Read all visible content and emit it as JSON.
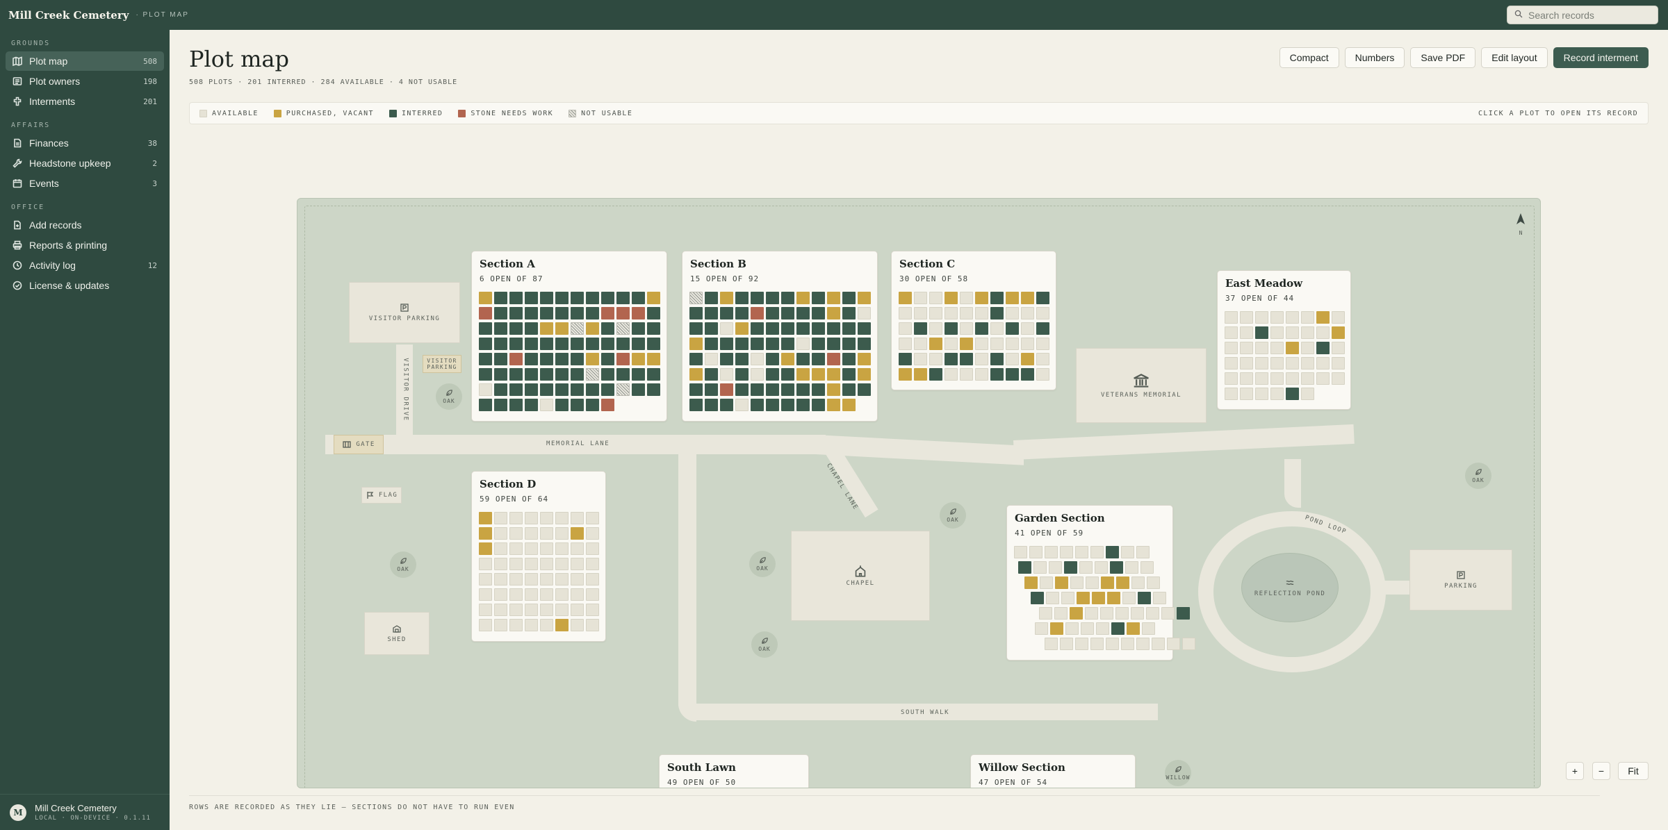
{
  "app": {
    "title": "Mill Creek Cemetery",
    "subtitle": "· PLOT MAP"
  },
  "search": {
    "placeholder": "Search records"
  },
  "sidebar": {
    "groups": [
      {
        "label": "GROUNDS",
        "items": [
          {
            "label": "Plot map",
            "count": "508",
            "icon": "map-icon",
            "active": true
          },
          {
            "label": "Plot owners",
            "count": "198",
            "icon": "list-icon"
          },
          {
            "label": "Interments",
            "count": "201",
            "icon": "cross-icon"
          }
        ]
      },
      {
        "label": "AFFAIRS",
        "items": [
          {
            "label": "Finances",
            "count": "38",
            "icon": "ledger-icon"
          },
          {
            "label": "Headstone upkeep",
            "count": "2",
            "icon": "wrench-icon"
          },
          {
            "label": "Events",
            "count": "3",
            "icon": "calendar-icon"
          }
        ]
      },
      {
        "label": "OFFICE",
        "items": [
          {
            "label": "Add records",
            "count": "",
            "icon": "doc-plus-icon"
          },
          {
            "label": "Reports & printing",
            "count": "",
            "icon": "printer-icon"
          },
          {
            "label": "Activity log",
            "count": "12",
            "icon": "clock-icon"
          },
          {
            "label": "License & updates",
            "count": "",
            "icon": "check-circle-icon"
          }
        ]
      }
    ],
    "footer": {
      "avatar": "M",
      "name": "Mill Creek Cemetery",
      "meta": "LOCAL · ON-DEVICE · 0.1.11"
    }
  },
  "header": {
    "title": "Plot map",
    "stats": "508 PLOTS · 201 INTERRED · 284 AVAILABLE · 4 NOT USABLE",
    "actions": {
      "compact": "Compact",
      "numbers": "Numbers",
      "save_pdf": "Save PDF",
      "edit_layout": "Edit layout",
      "record": "Record interment"
    }
  },
  "legend": {
    "items": [
      {
        "label": "AVAILABLE",
        "status": "a"
      },
      {
        "label": "PURCHASED, VACANT",
        "status": "p"
      },
      {
        "label": "INTERRED",
        "status": "i"
      },
      {
        "label": "STONE NEEDS WORK",
        "status": "s"
      },
      {
        "label": "NOT USABLE",
        "status": "n"
      }
    ],
    "hint": "CLICK A PLOT TO OPEN ITS RECORD"
  },
  "colors": {
    "available": "#e6e3d6",
    "purchased": "#c9a442",
    "interred": "#3c5b4d",
    "stone": "#b2654f",
    "brand": "#2f4a40"
  },
  "map": {
    "north": "N",
    "roads": {
      "memorial_lane": "MEMORIAL LANE",
      "visitor_drive": "VISITOR DRIVE",
      "chapel_lane": "CHAPEL LANE",
      "south_walk": "SOUTH WALK",
      "pond_loop": "POND LOOP"
    },
    "features": {
      "visitor_parking": "VISITOR PARKING",
      "visitor_parking_sign": "VISITOR PARKING",
      "gate": "GATE",
      "flag": "FLAG",
      "shed": "SHED",
      "chapel": "CHAPEL",
      "veterans": "VETERANS MEMORIAL",
      "pond": "REFLECTION POND",
      "parking": "PARKING",
      "oak": "OAK",
      "willow": "WILLOW"
    },
    "sections": [
      {
        "name": "Section A",
        "summary": "6 OPEN OF 87",
        "rows": [
          "piiiiiiiiiip",
          "siiiiiiisssi",
          "iiiippnpinii",
          "iiiiiiiiiiii",
          "iisiiiipispp",
          "iiiiiiiniiii",
          "aiiiiiiiinii",
          "iiiiaiiis"
        ]
      },
      {
        "name": "Section B",
        "summary": "15 OPEN OF 92",
        "rows": [
          "nipiiiipipip",
          "iiiisiiiipia",
          "iiapiiiiiiii",
          "piiiiiiaiiii",
          "iaiiaipiisip",
          "piaiaiipppip",
          "iisiiiiiipii",
          "iiiaiiiiipp"
        ]
      },
      {
        "name": "Section C",
        "summary": "30 OPEN OF 58",
        "rows": [
          "paapapippi",
          "aaaaaaiaaa",
          "aiaiaiaiai",
          "aapapaaaaa",
          "iaaiiaiapa",
          "ppiaaaiiia"
        ]
      },
      {
        "name": "East Meadow",
        "summary": "37 OPEN OF 44",
        "rows": [
          "aaaaaapa",
          "aaiaaaap",
          "aaaapaia",
          "aaaaaaaa",
          "aaaaaaaa",
          "aaaaia"
        ]
      },
      {
        "name": "Section D",
        "summary": "59 OPEN OF 64",
        "rows": [
          "paaaaaaa",
          "paaaaapa",
          "paaaaaaa",
          "aaaaaaaa",
          "aaaaaaaa",
          "aaaaaaaa",
          "aaaaaaaa",
          "aaaaapaa"
        ]
      },
      {
        "name": "Garden Section",
        "summary": "41 OPEN OF 59",
        "rows": [
          "aaaaaaiaa",
          "iaaiaaiaa",
          "papaappaa",
          "iaapppaia",
          "aapaaaaaai",
          "apaaaipa",
          "aaaaaaaaaa"
        ]
      },
      {
        "name": "South Lawn",
        "summary": "49 OPEN OF 50",
        "rows": []
      },
      {
        "name": "Willow Section",
        "summary": "47 OPEN OF 54",
        "rows": []
      }
    ]
  },
  "zoom": {
    "in": "+",
    "out": "−",
    "fit": "Fit"
  },
  "footer": {
    "note": "ROWS ARE RECORDED AS THEY LIE — SECTIONS DO NOT HAVE TO RUN EVEN"
  }
}
